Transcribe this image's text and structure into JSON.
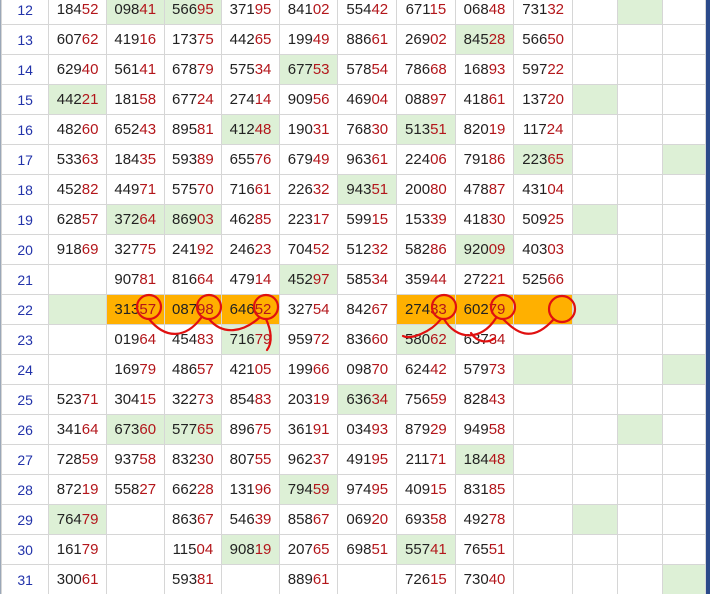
{
  "table": {
    "rows": [
      {
        "num": "12",
        "cells": [
          {
            "v": "18452",
            "hl": ""
          },
          {
            "v": "09841",
            "hl": "green"
          },
          {
            "v": "56695",
            "hl": "green"
          },
          {
            "v": "37195",
            "hl": ""
          },
          {
            "v": "84102",
            "hl": ""
          },
          {
            "v": "55442",
            "hl": ""
          },
          {
            "v": "67115",
            "hl": ""
          },
          {
            "v": "06848",
            "hl": ""
          },
          {
            "v": "73132",
            "hl": ""
          },
          {
            "v": "",
            "hl": ""
          },
          {
            "v": "",
            "hl": "green"
          },
          {
            "v": "",
            "hl": ""
          }
        ]
      },
      {
        "num": "13",
        "cells": [
          {
            "v": "60762",
            "hl": ""
          },
          {
            "v": "41916",
            "hl": ""
          },
          {
            "v": "17375",
            "hl": ""
          },
          {
            "v": "44265",
            "hl": ""
          },
          {
            "v": "19949",
            "hl": ""
          },
          {
            "v": "88661",
            "hl": ""
          },
          {
            "v": "26902",
            "hl": ""
          },
          {
            "v": "84528",
            "hl": "green"
          },
          {
            "v": "56650",
            "hl": ""
          },
          {
            "v": "",
            "hl": ""
          },
          {
            "v": "",
            "hl": ""
          },
          {
            "v": "",
            "hl": ""
          }
        ]
      },
      {
        "num": "14",
        "cells": [
          {
            "v": "62940",
            "hl": ""
          },
          {
            "v": "56141",
            "hl": ""
          },
          {
            "v": "67879",
            "hl": ""
          },
          {
            "v": "57534",
            "hl": ""
          },
          {
            "v": "67753",
            "hl": "green"
          },
          {
            "v": "57854",
            "hl": ""
          },
          {
            "v": "78668",
            "hl": ""
          },
          {
            "v": "16893",
            "hl": ""
          },
          {
            "v": "59722",
            "hl": ""
          },
          {
            "v": "",
            "hl": ""
          },
          {
            "v": "",
            "hl": ""
          },
          {
            "v": "",
            "hl": ""
          }
        ]
      },
      {
        "num": "15",
        "cells": [
          {
            "v": "44221",
            "hl": "green"
          },
          {
            "v": "18158",
            "hl": ""
          },
          {
            "v": "67724",
            "hl": ""
          },
          {
            "v": "27414",
            "hl": ""
          },
          {
            "v": "90956",
            "hl": ""
          },
          {
            "v": "46904",
            "hl": ""
          },
          {
            "v": "08897",
            "hl": ""
          },
          {
            "v": "41861",
            "hl": ""
          },
          {
            "v": "13720",
            "hl": ""
          },
          {
            "v": "",
            "hl": "green"
          },
          {
            "v": "",
            "hl": ""
          },
          {
            "v": "",
            "hl": ""
          }
        ]
      },
      {
        "num": "16",
        "cells": [
          {
            "v": "48260",
            "hl": ""
          },
          {
            "v": "65243",
            "hl": ""
          },
          {
            "v": "89581",
            "hl": ""
          },
          {
            "v": "41248",
            "hl": "green"
          },
          {
            "v": "19031",
            "hl": ""
          },
          {
            "v": "76830",
            "hl": ""
          },
          {
            "v": "51351",
            "hl": "green"
          },
          {
            "v": "82019",
            "hl": ""
          },
          {
            "v": "11724",
            "hl": ""
          },
          {
            "v": "",
            "hl": ""
          },
          {
            "v": "",
            "hl": ""
          },
          {
            "v": "",
            "hl": ""
          }
        ]
      },
      {
        "num": "17",
        "cells": [
          {
            "v": "53363",
            "hl": ""
          },
          {
            "v": "18435",
            "hl": ""
          },
          {
            "v": "59389",
            "hl": ""
          },
          {
            "v": "65576",
            "hl": ""
          },
          {
            "v": "67949",
            "hl": ""
          },
          {
            "v": "96361",
            "hl": ""
          },
          {
            "v": "22406",
            "hl": ""
          },
          {
            "v": "79186",
            "hl": ""
          },
          {
            "v": "22365",
            "hl": "green"
          },
          {
            "v": "",
            "hl": ""
          },
          {
            "v": "",
            "hl": ""
          },
          {
            "v": "",
            "hl": "green"
          }
        ]
      },
      {
        "num": "18",
        "cells": [
          {
            "v": "45282",
            "hl": ""
          },
          {
            "v": "44971",
            "hl": ""
          },
          {
            "v": "57570",
            "hl": ""
          },
          {
            "v": "71661",
            "hl": ""
          },
          {
            "v": "22632",
            "hl": ""
          },
          {
            "v": "94351",
            "hl": "green"
          },
          {
            "v": "20080",
            "hl": ""
          },
          {
            "v": "47887",
            "hl": ""
          },
          {
            "v": "43104",
            "hl": ""
          },
          {
            "v": "",
            "hl": ""
          },
          {
            "v": "",
            "hl": ""
          },
          {
            "v": "",
            "hl": ""
          }
        ]
      },
      {
        "num": "19",
        "cells": [
          {
            "v": "62857",
            "hl": ""
          },
          {
            "v": "37264",
            "hl": "green"
          },
          {
            "v": "86903",
            "hl": "green"
          },
          {
            "v": "46285",
            "hl": ""
          },
          {
            "v": "22317",
            "hl": ""
          },
          {
            "v": "59915",
            "hl": ""
          },
          {
            "v": "15339",
            "hl": ""
          },
          {
            "v": "41830",
            "hl": ""
          },
          {
            "v": "50925",
            "hl": ""
          },
          {
            "v": "",
            "hl": "green"
          },
          {
            "v": "",
            "hl": ""
          },
          {
            "v": "",
            "hl": ""
          }
        ]
      },
      {
        "num": "20",
        "cells": [
          {
            "v": "91869",
            "hl": ""
          },
          {
            "v": "32775",
            "hl": ""
          },
          {
            "v": "24192",
            "hl": ""
          },
          {
            "v": "24623",
            "hl": ""
          },
          {
            "v": "70452",
            "hl": ""
          },
          {
            "v": "51232",
            "hl": ""
          },
          {
            "v": "58286",
            "hl": ""
          },
          {
            "v": "92009",
            "hl": "green"
          },
          {
            "v": "40303",
            "hl": ""
          },
          {
            "v": "",
            "hl": ""
          },
          {
            "v": "",
            "hl": ""
          },
          {
            "v": "",
            "hl": ""
          }
        ]
      },
      {
        "num": "21",
        "cells": [
          {
            "v": "",
            "hl": ""
          },
          {
            "v": "90781",
            "hl": ""
          },
          {
            "v": "81664",
            "hl": ""
          },
          {
            "v": "47914",
            "hl": ""
          },
          {
            "v": "45297",
            "hl": "green"
          },
          {
            "v": "58534",
            "hl": ""
          },
          {
            "v": "35944",
            "hl": ""
          },
          {
            "v": "27221",
            "hl": ""
          },
          {
            "v": "52566",
            "hl": ""
          },
          {
            "v": "",
            "hl": ""
          },
          {
            "v": "",
            "hl": ""
          },
          {
            "v": "",
            "hl": ""
          }
        ]
      },
      {
        "num": "22",
        "cells": [
          {
            "v": "",
            "hl": "green"
          },
          {
            "v": "31357",
            "hl": "orange"
          },
          {
            "v": "08798",
            "hl": "orange"
          },
          {
            "v": "64652",
            "hl": "orange"
          },
          {
            "v": "32754",
            "hl": ""
          },
          {
            "v": "84267",
            "hl": ""
          },
          {
            "v": "27433",
            "hl": "orange"
          },
          {
            "v": "60279",
            "hl": "orange"
          },
          {
            "v": "",
            "hl": "orange"
          },
          {
            "v": "",
            "hl": "green"
          },
          {
            "v": "",
            "hl": ""
          },
          {
            "v": "",
            "hl": ""
          }
        ]
      },
      {
        "num": "23",
        "cells": [
          {
            "v": "",
            "hl": ""
          },
          {
            "v": "01964",
            "hl": ""
          },
          {
            "v": "45483",
            "hl": ""
          },
          {
            "v": "71679",
            "hl": "green"
          },
          {
            "v": "95972",
            "hl": ""
          },
          {
            "v": "83660",
            "hl": ""
          },
          {
            "v": "58062",
            "hl": "green"
          },
          {
            "v": "63734",
            "hl": ""
          },
          {
            "v": "",
            "hl": ""
          },
          {
            "v": "",
            "hl": ""
          },
          {
            "v": "",
            "hl": ""
          },
          {
            "v": "",
            "hl": ""
          }
        ]
      },
      {
        "num": "24",
        "cells": [
          {
            "v": "",
            "hl": ""
          },
          {
            "v": "16979",
            "hl": ""
          },
          {
            "v": "48657",
            "hl": ""
          },
          {
            "v": "42105",
            "hl": ""
          },
          {
            "v": "19966",
            "hl": ""
          },
          {
            "v": "09870",
            "hl": ""
          },
          {
            "v": "62442",
            "hl": ""
          },
          {
            "v": "57973",
            "hl": ""
          },
          {
            "v": "",
            "hl": "green"
          },
          {
            "v": "",
            "hl": ""
          },
          {
            "v": "",
            "hl": ""
          },
          {
            "v": "",
            "hl": "green"
          }
        ]
      },
      {
        "num": "25",
        "cells": [
          {
            "v": "52371",
            "hl": ""
          },
          {
            "v": "30415",
            "hl": ""
          },
          {
            "v": "32273",
            "hl": ""
          },
          {
            "v": "85483",
            "hl": ""
          },
          {
            "v": "20319",
            "hl": ""
          },
          {
            "v": "63634",
            "hl": "green"
          },
          {
            "v": "75659",
            "hl": ""
          },
          {
            "v": "82843",
            "hl": ""
          },
          {
            "v": "",
            "hl": ""
          },
          {
            "v": "",
            "hl": ""
          },
          {
            "v": "",
            "hl": ""
          },
          {
            "v": "",
            "hl": ""
          }
        ]
      },
      {
        "num": "26",
        "cells": [
          {
            "v": "34164",
            "hl": ""
          },
          {
            "v": "67360",
            "hl": "green"
          },
          {
            "v": "57765",
            "hl": "green"
          },
          {
            "v": "89675",
            "hl": ""
          },
          {
            "v": "36191",
            "hl": ""
          },
          {
            "v": "03493",
            "hl": ""
          },
          {
            "v": "87929",
            "hl": ""
          },
          {
            "v": "94958",
            "hl": ""
          },
          {
            "v": "",
            "hl": ""
          },
          {
            "v": "",
            "hl": ""
          },
          {
            "v": "",
            "hl": "green"
          },
          {
            "v": "",
            "hl": ""
          }
        ]
      },
      {
        "num": "27",
        "cells": [
          {
            "v": "72859",
            "hl": ""
          },
          {
            "v": "93758",
            "hl": ""
          },
          {
            "v": "83230",
            "hl": ""
          },
          {
            "v": "80755",
            "hl": ""
          },
          {
            "v": "96237",
            "hl": ""
          },
          {
            "v": "49195",
            "hl": ""
          },
          {
            "v": "21171",
            "hl": ""
          },
          {
            "v": "18448",
            "hl": "green"
          },
          {
            "v": "",
            "hl": ""
          },
          {
            "v": "",
            "hl": ""
          },
          {
            "v": "",
            "hl": ""
          },
          {
            "v": "",
            "hl": ""
          }
        ]
      },
      {
        "num": "28",
        "cells": [
          {
            "v": "87219",
            "hl": ""
          },
          {
            "v": "55827",
            "hl": ""
          },
          {
            "v": "66228",
            "hl": ""
          },
          {
            "v": "13196",
            "hl": ""
          },
          {
            "v": "79459",
            "hl": "green"
          },
          {
            "v": "97495",
            "hl": ""
          },
          {
            "v": "40915",
            "hl": ""
          },
          {
            "v": "83185",
            "hl": ""
          },
          {
            "v": "",
            "hl": ""
          },
          {
            "v": "",
            "hl": ""
          },
          {
            "v": "",
            "hl": ""
          },
          {
            "v": "",
            "hl": ""
          }
        ]
      },
      {
        "num": "29",
        "cells": [
          {
            "v": "76479",
            "hl": "green"
          },
          {
            "v": "",
            "hl": ""
          },
          {
            "v": "86367",
            "hl": ""
          },
          {
            "v": "54639",
            "hl": ""
          },
          {
            "v": "85867",
            "hl": ""
          },
          {
            "v": "06920",
            "hl": ""
          },
          {
            "v": "69358",
            "hl": ""
          },
          {
            "v": "49278",
            "hl": ""
          },
          {
            "v": "",
            "hl": ""
          },
          {
            "v": "",
            "hl": "green"
          },
          {
            "v": "",
            "hl": ""
          },
          {
            "v": "",
            "hl": ""
          }
        ]
      },
      {
        "num": "30",
        "cells": [
          {
            "v": "16179",
            "hl": ""
          },
          {
            "v": "",
            "hl": ""
          },
          {
            "v": "11504",
            "hl": ""
          },
          {
            "v": "90819",
            "hl": "green"
          },
          {
            "v": "20765",
            "hl": ""
          },
          {
            "v": "69851",
            "hl": ""
          },
          {
            "v": "55741",
            "hl": "green"
          },
          {
            "v": "76551",
            "hl": ""
          },
          {
            "v": "",
            "hl": ""
          },
          {
            "v": "",
            "hl": ""
          },
          {
            "v": "",
            "hl": ""
          },
          {
            "v": "",
            "hl": ""
          }
        ]
      },
      {
        "num": "31",
        "cells": [
          {
            "v": "30061",
            "hl": ""
          },
          {
            "v": "",
            "hl": ""
          },
          {
            "v": "59381",
            "hl": ""
          },
          {
            "v": "",
            "hl": ""
          },
          {
            "v": "88961",
            "hl": ""
          },
          {
            "v": "",
            "hl": ""
          },
          {
            "v": "72615",
            "hl": ""
          },
          {
            "v": "73040",
            "hl": ""
          },
          {
            "v": "",
            "hl": ""
          },
          {
            "v": "",
            "hl": ""
          },
          {
            "v": "",
            "hl": ""
          },
          {
            "v": "",
            "hl": "green"
          }
        ]
      }
    ]
  },
  "colors": {
    "highlight_green": "#ddf0d6",
    "highlight_orange": "#ffb000",
    "suffix_red": "#b3161b",
    "annotation_red": "#e01010",
    "row_number_blue": "#2233aa"
  },
  "annotations": {
    "type": "hand-drawn red circles connected by curved strokes",
    "circled_row": "22",
    "circled_suffixes": [
      "57",
      "98",
      "52",
      "33",
      "79"
    ]
  }
}
